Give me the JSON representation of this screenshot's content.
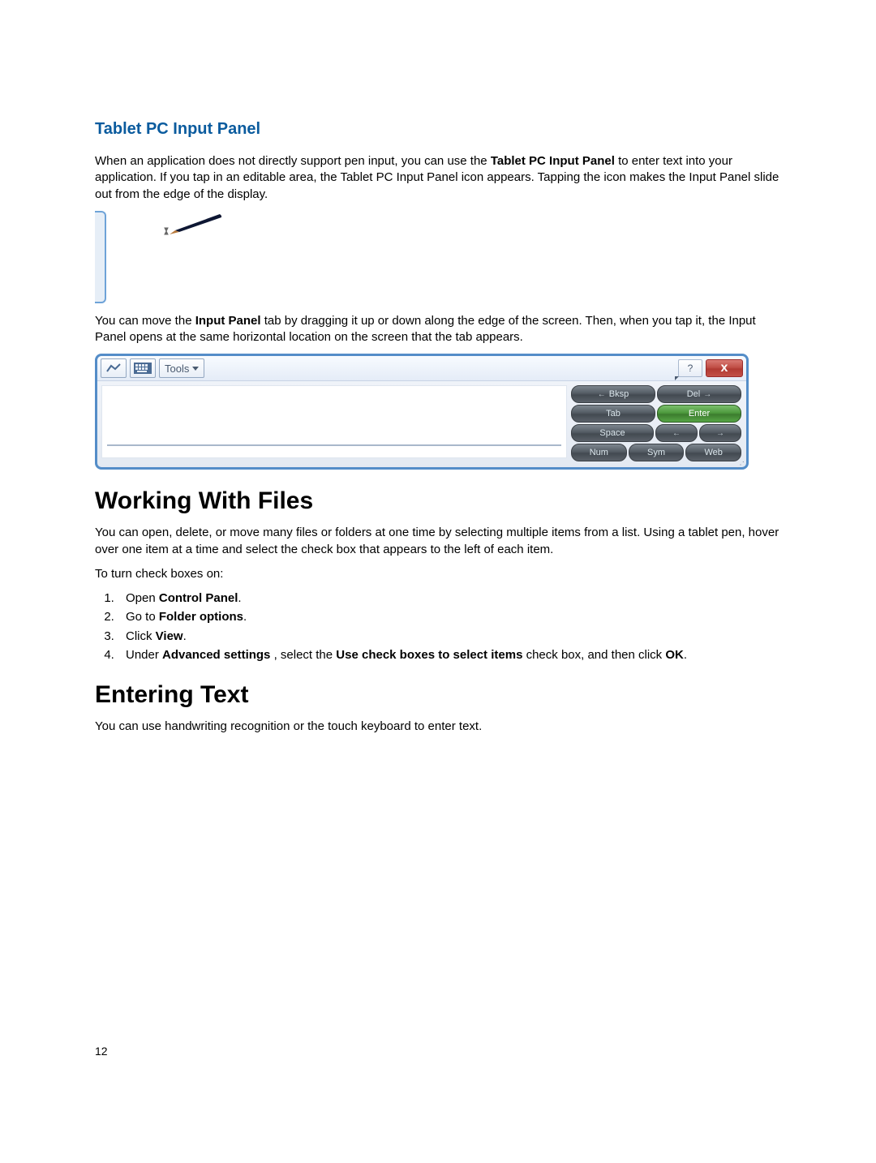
{
  "section1": {
    "title": "Tablet PC Input Panel",
    "p1_a": "When an application does not directly support pen input, you can use the ",
    "p1_b": "Tablet PC Input Panel",
    "p1_c": " to enter text into your application. If you tap in an editable area, the Tablet PC Input Panel icon appears. Tapping the icon makes the Input Panel slide out from the edge of the display.",
    "p2_a": "You can move the ",
    "p2_b": "Input Panel",
    "p2_c": " tab by dragging it up or down along the edge of the screen. Then, when you tap it, the Input Panel opens at the same horizontal location on the screen that the tab appears."
  },
  "tip": {
    "tools_label": "Tools",
    "help_label": "?",
    "close_label": "x",
    "rows": {
      "r1": {
        "left_arrow": "←",
        "left_label": "Bksp",
        "right_label": "Del",
        "right_arrow": "→"
      },
      "r2": {
        "left": "Tab",
        "right": "Enter"
      },
      "r3": {
        "left": "Space",
        "right_left_arrow": "←",
        "right_right_arrow": "→"
      },
      "r4": {
        "a": "Num",
        "b": "Sym",
        "c": "Web"
      }
    }
  },
  "section2": {
    "title": "Working With Files",
    "p1": "You can open, delete, or move many files or folders at one time by selecting multiple items from a list. Using a tablet pen, hover over one item at a time and select the check box that appears to the left of each item.",
    "p2": "To turn check boxes on:",
    "li1_a": "Open ",
    "li1_b": "Control Panel",
    "li1_c": ".",
    "li2_a": "Go to ",
    "li2_b": "Folder options",
    "li2_c": ".",
    "li3_a": "Click ",
    "li3_b": "View",
    "li3_c": ".",
    "li4_a": "Under ",
    "li4_b": "Advanced settings ",
    "li4_c": ", select the ",
    "li4_d": "Use check boxes to select items",
    "li4_e": " check box, and then click ",
    "li4_f": "OK",
    "li4_g": "."
  },
  "section3": {
    "title": "Entering Text",
    "p1": "You can use handwriting recognition or the touch keyboard to enter text."
  },
  "page_number": "12"
}
